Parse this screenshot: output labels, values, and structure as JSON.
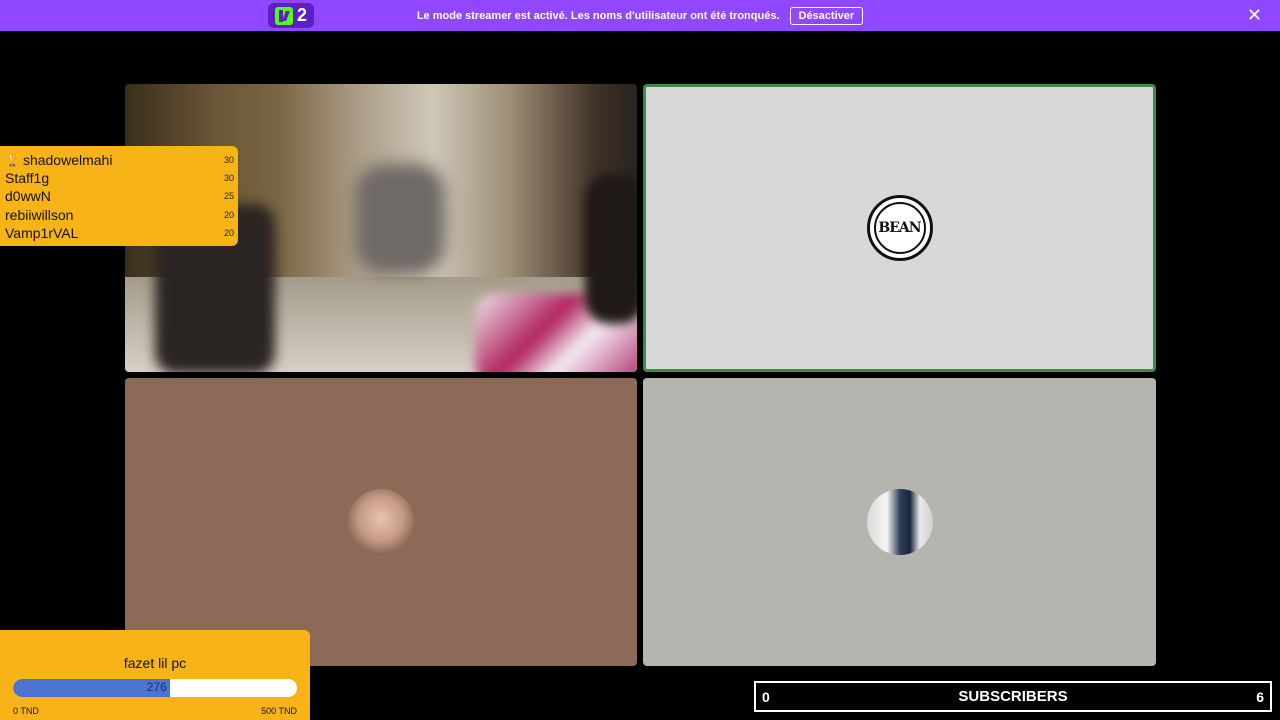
{
  "banner": {
    "app_name": "Kick 2",
    "logo_number": "2",
    "message": "Le mode streamer est activé. Les noms d'utilisateur ont été tronqués.",
    "button_label": "Désactiver",
    "close_icon": "close-icon"
  },
  "tiles": [
    {
      "name": "camera-feed",
      "type": "video"
    },
    {
      "name": "participant-bean",
      "avatar_text": "BEAN",
      "active_speaker": true
    },
    {
      "name": "participant-face",
      "avatar": "avatar-face"
    },
    {
      "name": "participant-photo",
      "avatar": "avatar-photo"
    }
  ],
  "leaderboard": {
    "top_icon": "trophy-icon",
    "entries": [
      {
        "name": "shadowelmahi",
        "score": "30"
      },
      {
        "name": "Staff1g",
        "score": "30"
      },
      {
        "name": "d0wwN",
        "score": "25"
      },
      {
        "name": "rebiiwillson",
        "score": "20"
      },
      {
        "name": "Vamp1rVAL",
        "score": "20"
      }
    ]
  },
  "goal": {
    "title": "fazet lil pc",
    "current": "276",
    "fraction": 0.552,
    "min_label": "0 TND",
    "max_label": "500 TND"
  },
  "subscribers": {
    "left": "0",
    "label": "SUBSCRIBERS",
    "right": "6"
  },
  "colors": {
    "banner": "#9146ff",
    "accent": "#f8b416",
    "active_border": "#3d8b45",
    "progress": "#4a73d2"
  }
}
